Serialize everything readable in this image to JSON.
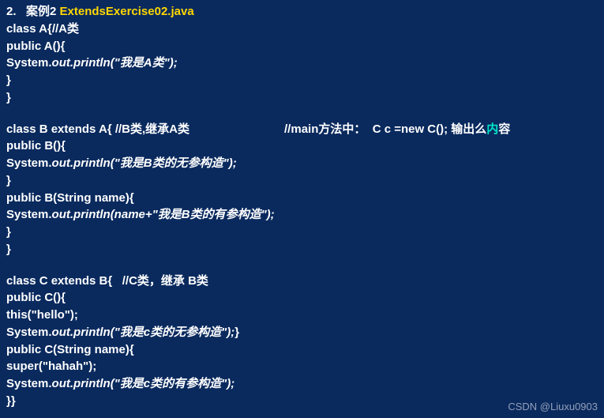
{
  "title": {
    "num": "2.",
    "case": "案例2",
    "filename": "ExtendsExercise02.java"
  },
  "blockA": {
    "l1": "class A{",
    "l1_comment": "//A类",
    "l2": "public A(){",
    "l3_pre": "System.",
    "l3_ital": "out.println(\"我是A类\");",
    "l4": "}",
    "l5": "}"
  },
  "blockB": {
    "l1": "class B extends A{ ",
    "l1_comment": "//B类,继承A类",
    "l1_main_comment_a": "//main方法中：  C c =new C(); 输出么",
    "l1_main_comment_b": "内",
    "l1_main_comment_c": "容",
    "l2": "public B(){",
    "l3_pre": "System.",
    "l3_ital": "out.println(\"我是B类的无参构造\");",
    "l4": "}",
    "l5": "public B(String name){",
    "l6_pre": "System.",
    "l6_ital": "out.println(name+\"我是B类的有参构造\");",
    "l7": "}",
    "l8": "}"
  },
  "blockC": {
    "l1": "class C extends B{   ",
    "l1_comment": "//C类，继承 B类",
    "l2": "public C(){",
    "l3": "this(\"hello\");",
    "l4_pre": "System.",
    "l4_ital": "out.println(\"我是c类的无参构造\");",
    "l4_post": "}",
    "l5": "public C(String name){",
    "l6": "super(\"hahah\");",
    "l7_pre": "System.",
    "l7_ital": "out.println(\"我是c类的有参构造\");",
    "l8": "}}"
  },
  "watermark": "CSDN @Liuxu0903"
}
